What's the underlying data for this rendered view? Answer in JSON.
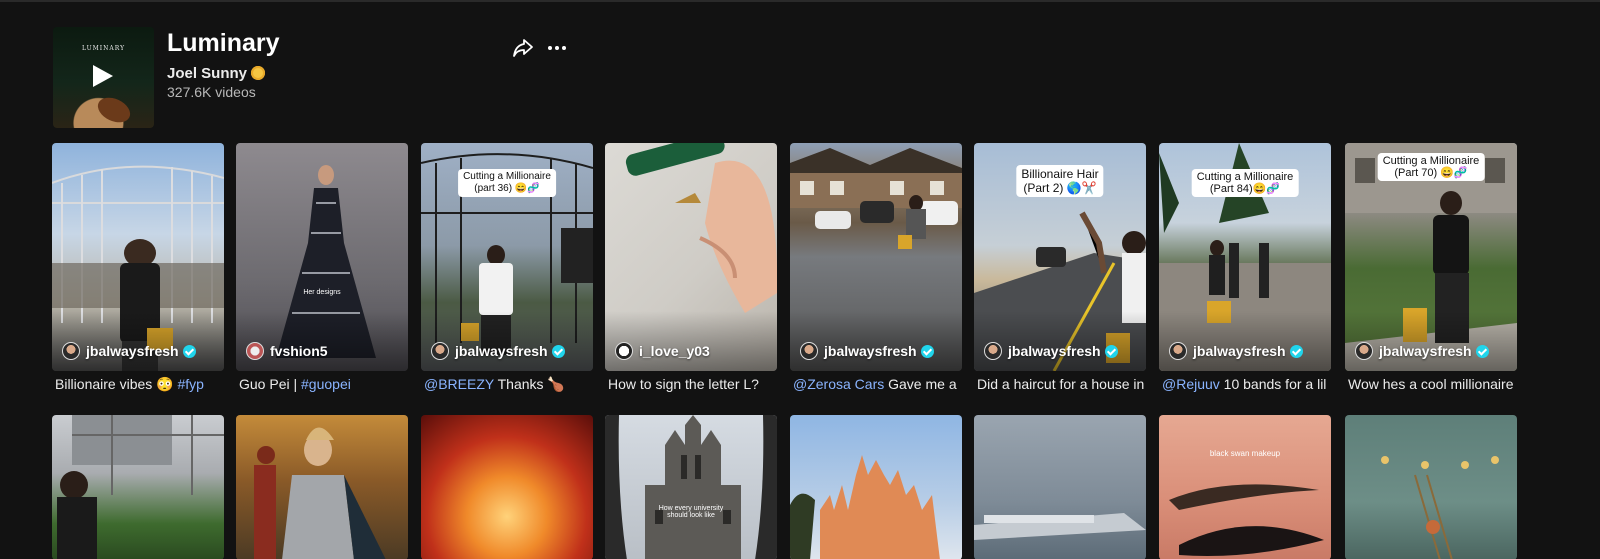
{
  "playlist": {
    "cover_logo": "LUMINARY",
    "title": "Luminary",
    "artist": "Joel Sunny",
    "video_count": "327.6K videos"
  },
  "actions": {
    "share_icon": "share-icon",
    "more_icon": "more-icon"
  },
  "videos": [
    {
      "author": "jbalwaysfresh",
      "verified": true,
      "caption_text": "Billionaire vibes 😳 ",
      "caption_tag": "#fyp",
      "overlay_label": "",
      "overlay_text": ""
    },
    {
      "author": "fvshion5",
      "verified": false,
      "caption_text": "Guo Pei | ",
      "caption_tag": "#guopei",
      "overlay_label": "",
      "overlay_text": "Her designs"
    },
    {
      "author": "jbalwaysfresh",
      "verified": true,
      "caption_tag": "@BREEZY",
      "caption_text": " Thanks 🍗",
      "overlay_label": "Cutting a Millionaire\n(part 36) 😄🧬",
      "overlay_text": ""
    },
    {
      "author": "i_love_y03",
      "verified": false,
      "caption_text": "How to sign the letter L?",
      "caption_tag": "",
      "overlay_label": "",
      "overlay_text": ""
    },
    {
      "author": "jbalwaysfresh",
      "verified": true,
      "caption_tag": "@Zerosa Cars",
      "caption_text": " Gave me a",
      "overlay_label": "",
      "overlay_text": ""
    },
    {
      "author": "jbalwaysfresh",
      "verified": true,
      "caption_text": "Did a haircut for a house in",
      "caption_tag": "",
      "overlay_label": "Billionaire Hair\n(Part 2) 🌎✂️",
      "overlay_text": ""
    },
    {
      "author": "jbalwaysfresh",
      "verified": true,
      "caption_tag": "@Rejuuv",
      "caption_text": " 10 bands for a lil",
      "overlay_label": "Cutting a Millionaire\n(Part 84)😄🧬",
      "overlay_text": ""
    },
    {
      "author": "jbalwaysfresh",
      "verified": true,
      "caption_text": "Wow hes a cool millionaire",
      "caption_tag": "",
      "overlay_label": "Cutting a Millionaire\n(Part 70) 😄🧬",
      "overlay_text": ""
    }
  ],
  "videos_row2": [
    {
      "overlay_text": ""
    },
    {
      "overlay_text": ""
    },
    {
      "overlay_text": ""
    },
    {
      "overlay_text": "How every university\nshould look like"
    },
    {
      "overlay_text": ""
    },
    {
      "overlay_text": ""
    },
    {
      "overlay_text": "black swan makeup"
    },
    {
      "overlay_text": ""
    }
  ],
  "colors": {
    "background": "#121212",
    "link": "#8ab4ff",
    "verified": "#20d5ec"
  }
}
